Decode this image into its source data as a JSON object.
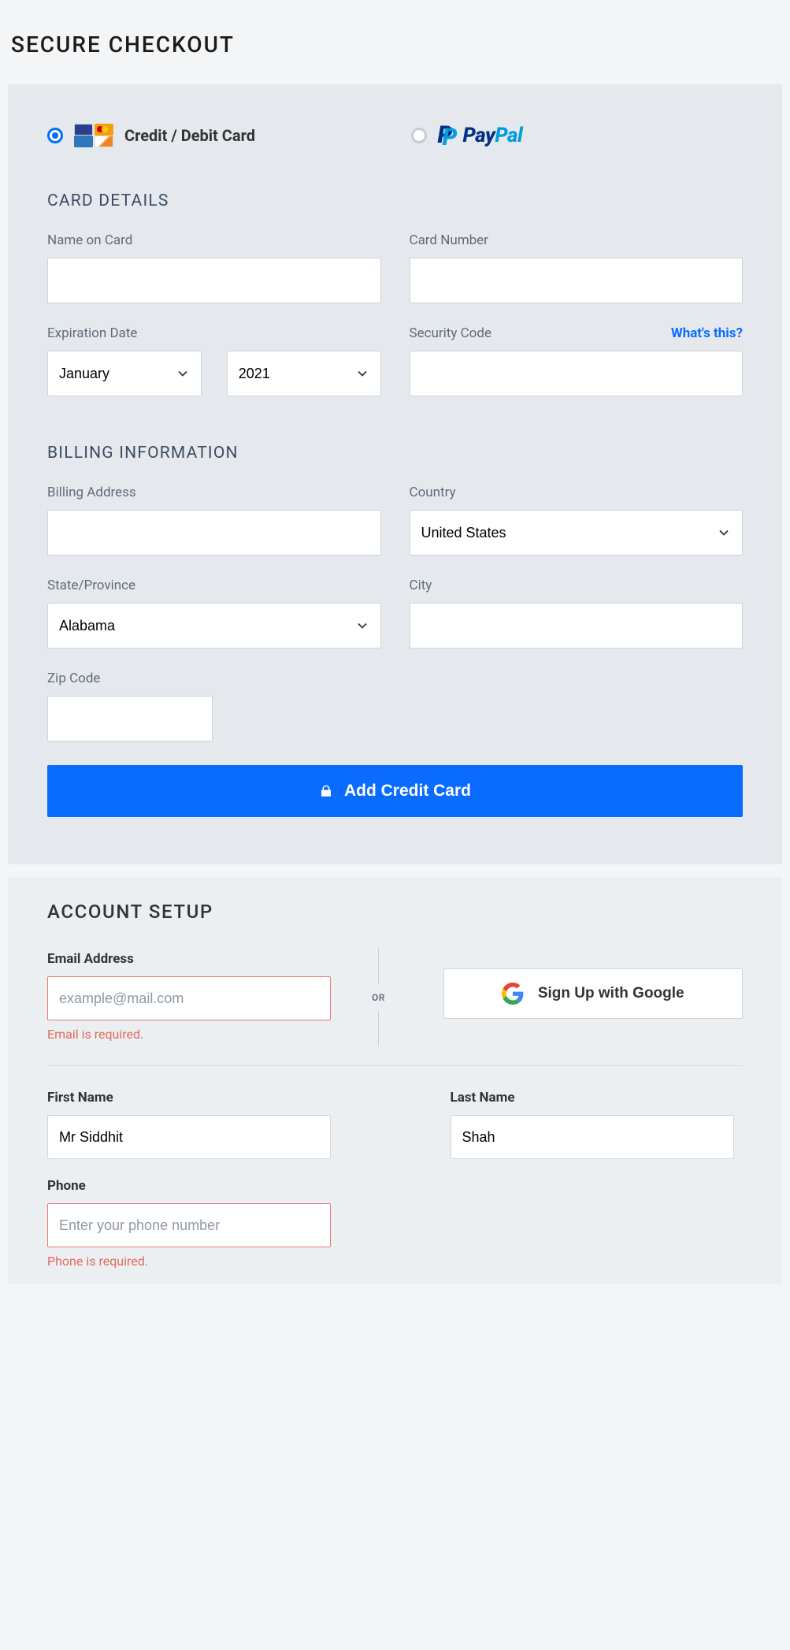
{
  "page": {
    "title": "SECURE CHECKOUT"
  },
  "payment": {
    "credit_label": "Credit / Debit Card",
    "paypal_pay": "Pay",
    "paypal_pal": "Pal"
  },
  "card": {
    "section_title": "CARD DETAILS",
    "name_label": "Name on Card",
    "number_label": "Card Number",
    "expiration_label": "Expiration Date",
    "security_label": "Security Code",
    "whats_this": "What's this?",
    "month_selected": "January",
    "year_selected": "2021"
  },
  "billing": {
    "section_title": "BILLING INFORMATION",
    "address_label": "Billing Address",
    "country_label": "Country",
    "country_selected": "United States",
    "state_label": "State/Province",
    "state_selected": "Alabama",
    "city_label": "City",
    "zip_label": "Zip Code"
  },
  "submit": {
    "button_label": "Add Credit Card"
  },
  "account": {
    "section_title": "ACCOUNT SETUP",
    "email_label": "Email Address",
    "email_placeholder": "example@mail.com",
    "email_error": "Email is required.",
    "or_label": "OR",
    "google_label": "Sign Up with Google",
    "first_name_label": "First Name",
    "first_name_value": "Mr Siddhit",
    "last_name_label": "Last Name",
    "last_name_value": "Shah",
    "phone_label": "Phone",
    "phone_placeholder": "Enter your phone number",
    "phone_error": "Phone is required."
  }
}
